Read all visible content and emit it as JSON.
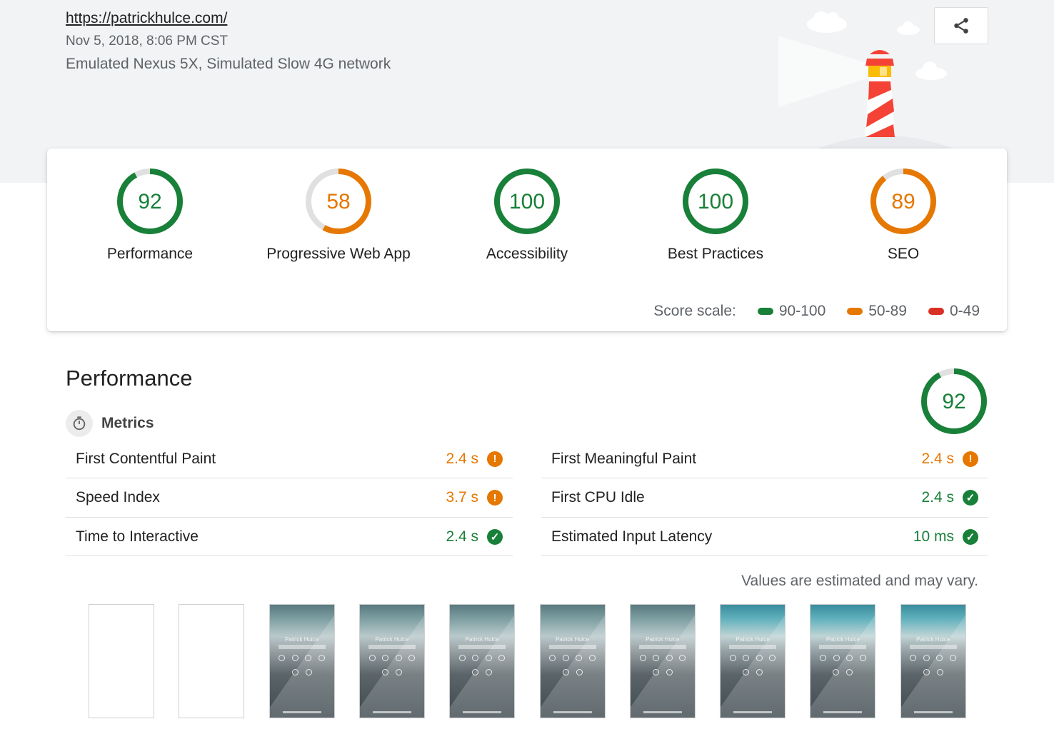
{
  "header": {
    "url": "https://patrickhulce.com/",
    "datetime": "Nov 5, 2018, 8:06 PM CST",
    "environment": "Emulated Nexus 5X, Simulated Slow 4G network"
  },
  "colors": {
    "pass": "#188038",
    "average": "#e67700",
    "fail": "#d93025",
    "track": "#e0e0e0",
    "header_bg": "#f1f3f4"
  },
  "scores": [
    {
      "label": "Performance",
      "score": 92
    },
    {
      "label": "Progressive Web App",
      "score": 58
    },
    {
      "label": "Accessibility",
      "score": 100
    },
    {
      "label": "Best Practices",
      "score": 100
    },
    {
      "label": "SEO",
      "score": 89
    }
  ],
  "scale": {
    "label": "Score scale:",
    "ranges": [
      "90-100",
      "50-89",
      "0-49"
    ]
  },
  "performance": {
    "title": "Performance",
    "score": 92,
    "metrics_label": "Metrics",
    "metrics_left": [
      {
        "name": "First Contentful Paint",
        "value": "2.4 s",
        "status": "average"
      },
      {
        "name": "Speed Index",
        "value": "3.7 s",
        "status": "average"
      },
      {
        "name": "Time to Interactive",
        "value": "2.4 s",
        "status": "pass"
      }
    ],
    "metrics_right": [
      {
        "name": "First Meaningful Paint",
        "value": "2.4 s",
        "status": "average"
      },
      {
        "name": "First CPU Idle",
        "value": "2.4 s",
        "status": "pass"
      },
      {
        "name": "Estimated Input Latency",
        "value": "10 ms",
        "status": "pass"
      }
    ],
    "note": "Values are estimated and may vary."
  },
  "filmstrip": {
    "frame_text": "Patrick Hulce",
    "frames": [
      "blank",
      "blank",
      "loaded",
      "loaded",
      "loaded",
      "loaded",
      "loaded",
      "loaded-color",
      "loaded-color",
      "loaded-color"
    ]
  },
  "icons": {
    "share": "share-icon",
    "timer": "timer-icon",
    "average": "info-icon",
    "pass": "check-icon"
  }
}
